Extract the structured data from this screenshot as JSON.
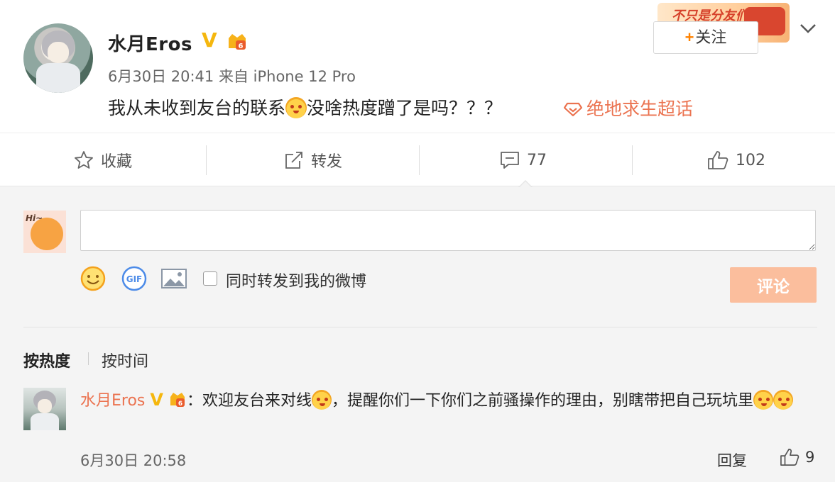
{
  "post": {
    "user_name": "水月Eros",
    "verified_mark": "V",
    "time": "6月30日 20:41",
    "source_prefix": "来自",
    "source": "iPhone 12 Pro",
    "text_before_emoji": "我从未收到友台的联系",
    "text_after_emoji": "没啥热度蹭了是吗？？？",
    "topic": "绝地求生超话",
    "follow_label": "关注",
    "follow_plus": "+",
    "banner_text": "不只是分友们"
  },
  "actions": {
    "favorite": "收藏",
    "repost": "转发",
    "comment_count": "77",
    "like_count": "102"
  },
  "composer": {
    "input_value": "",
    "repost_checkbox_label": "同时转发到我的微博",
    "repost_checked": false,
    "submit_label": "评论",
    "avatar_text": "Hi~"
  },
  "sort": {
    "hot": "按热度",
    "time": "按时间"
  },
  "comment": {
    "user_name": "水月Eros",
    "verified_mark": "V",
    "colon": "：",
    "text_1": "欢迎友台来对线",
    "text_2": "，提醒你们一下你们之前骚操作的理由，别瞎带把自己玩坑里",
    "time": "6月30日 20:58",
    "reply_label": "回复",
    "like_count": "9"
  },
  "colors": {
    "accent_orange": "#eb7350",
    "verified_gold": "#f5b70e",
    "submit_disabled": "#fbbe9d",
    "background_gray": "#f4f4f4"
  },
  "icons": [
    "star-icon",
    "share-icon",
    "comment-icon",
    "thumbs-up-icon",
    "chevron-down-icon",
    "smile-icon",
    "gif-icon",
    "image-icon",
    "topic-icon"
  ]
}
